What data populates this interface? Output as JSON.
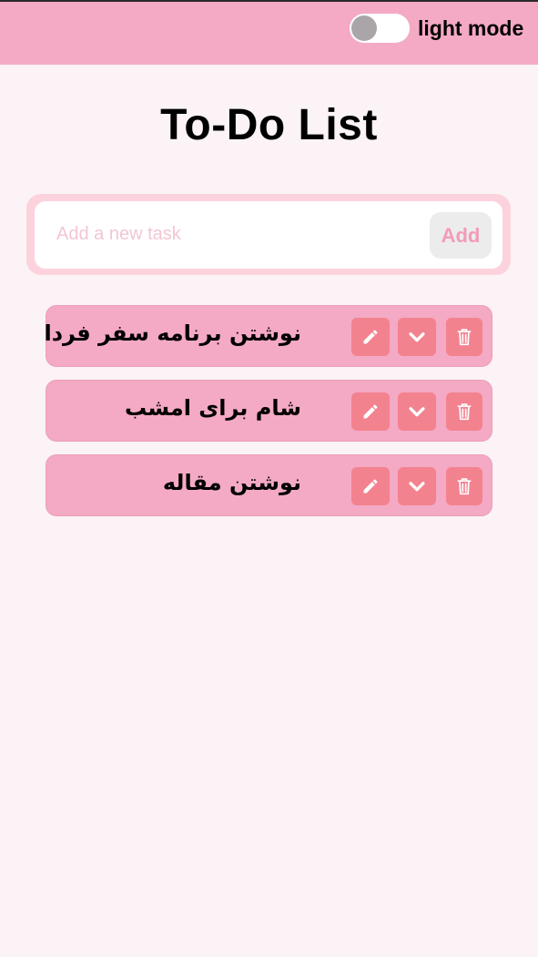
{
  "header": {
    "mode_label": "light mode",
    "toggle_on": false,
    "background_color": "#f4a9c4"
  },
  "main": {
    "title": "To-Do List",
    "new_task": {
      "placeholder": "Add a new task",
      "value": "",
      "add_label": "Add"
    },
    "tasks": [
      {
        "text": "نوشتن برنامه سفر فردا",
        "actions": [
          "pencil-icon",
          "chevron-down-icon",
          "trash-icon"
        ]
      },
      {
        "text": "شام برای امشب",
        "actions": [
          "pencil-icon",
          "chevron-down-icon",
          "trash-icon"
        ]
      },
      {
        "text": "نوشتن مقاله",
        "actions": [
          "pencil-icon",
          "chevron-down-icon",
          "trash-icon"
        ]
      }
    ]
  },
  "colors": {
    "page_background": "#fbf3f5",
    "task_background": "#f4a9c4",
    "action_button": "#f3828f",
    "input_frame": "#fcd3dd",
    "add_text": "#f29bb8"
  }
}
